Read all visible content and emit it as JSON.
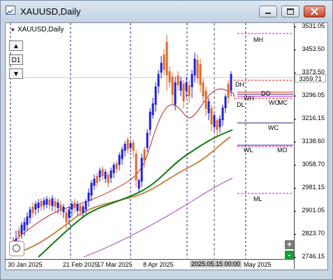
{
  "window": {
    "title": "XAUUSD,Daily",
    "icon": "chart-window-icon",
    "controls": [
      "minimize-icon",
      "restore-icon",
      "close-icon"
    ]
  },
  "chart": {
    "symbol_label": "XAUUSD,Daily",
    "timeframe_up": "▲",
    "timeframe_label": "D1",
    "timeframe_down": "▼",
    "current_price": "3359.71",
    "zoom_in": "+",
    "zoom_out": "-",
    "price_labels": [
      "3531.05",
      "3453.50",
      "3373.50",
      "3296.05",
      "3216.15",
      "3138.60",
      "3058.70",
      "2981.15",
      "2901.05",
      "2823.70",
      "2746.15"
    ],
    "date_labels": [
      "30 Jan 2025",
      "21 Feb 2025",
      "17 Mar 2025",
      "8 Apr 2025",
      "2025.05.15 00:00",
      "May 2025"
    ],
    "levels": {
      "MH": "MH",
      "DH": "DH",
      "DO": "DO",
      "WH": "WH",
      "WO": "WO",
      "MC": "MC",
      "DL": "DL",
      "WC": "WC",
      "WL": "WL",
      "MO": "MO",
      "ML": "ML"
    },
    "colors": {
      "bull": "#1f1fd6",
      "bear": "#e06a2a",
      "ema_fast": "#c81e1e",
      "ema_mid": "#0e7a0e",
      "ema_slow": "#c9874a",
      "ema_long": "#a33fbf",
      "magenta": "#c41bc4",
      "navy": "#22227a",
      "red": "#d91c1c"
    }
  }
}
